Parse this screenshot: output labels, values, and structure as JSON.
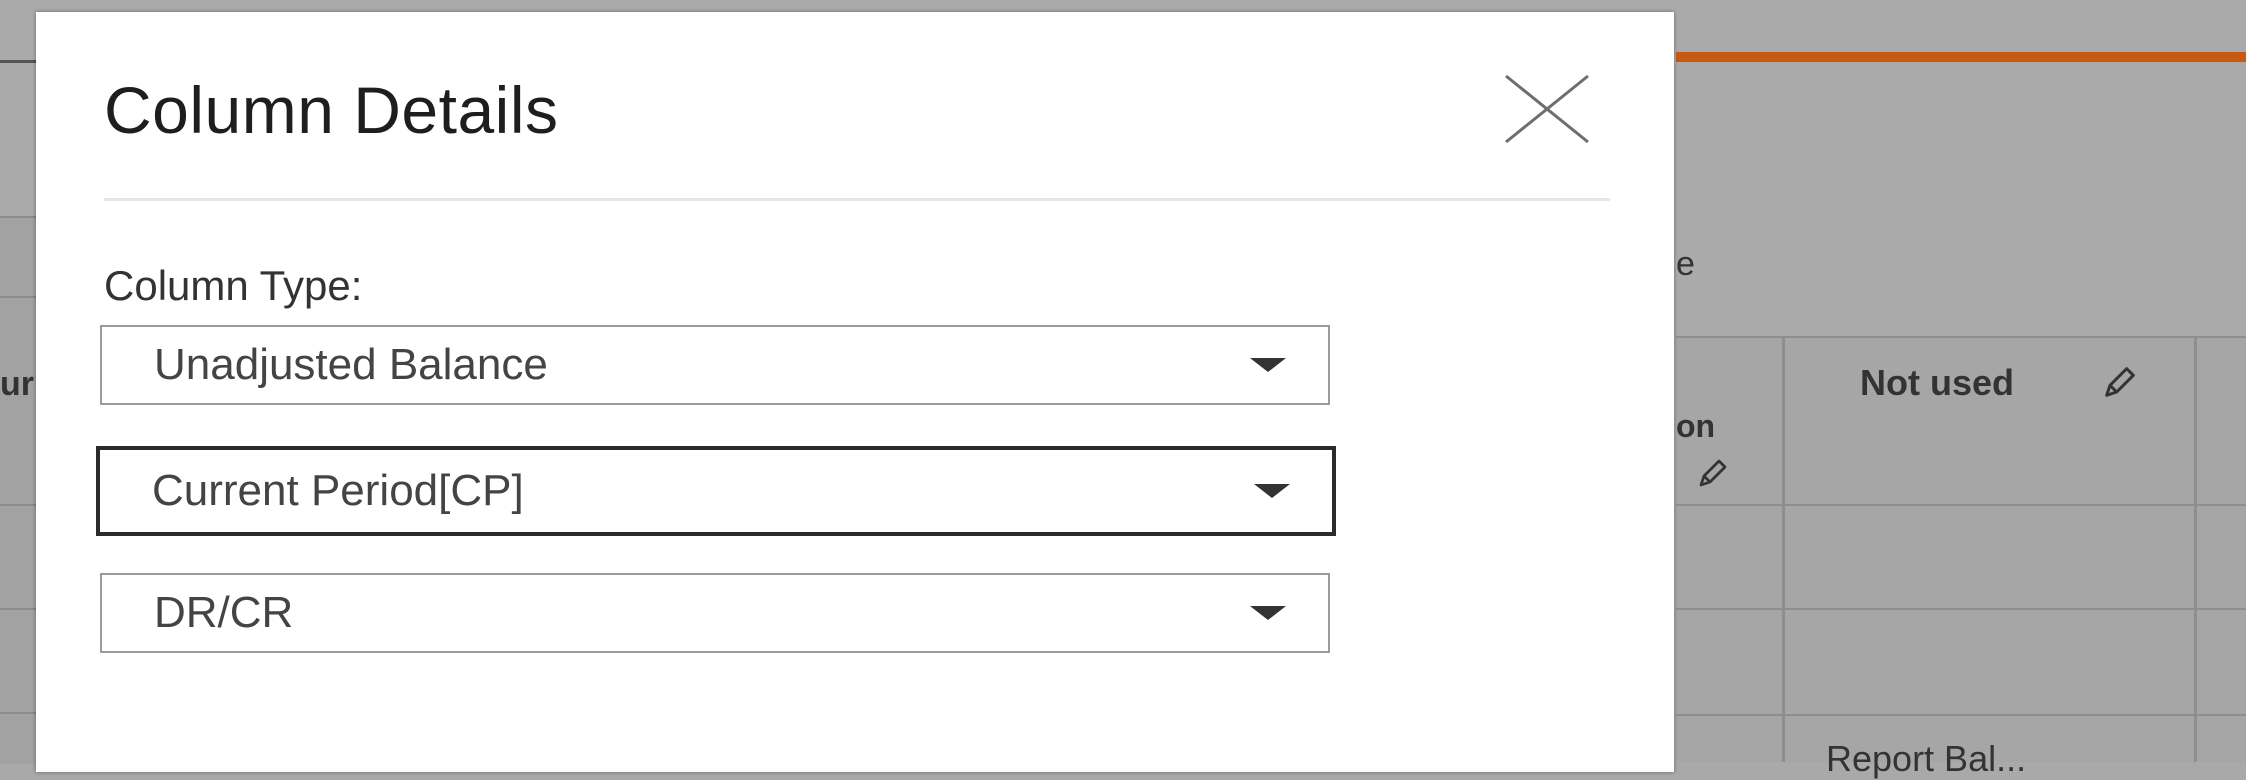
{
  "background": {
    "left_partial_text": "ur",
    "partial_e": "e",
    "table": {
      "header_partial": "on",
      "header_not_used": "Not used",
      "cell_partial": "Report Bal..."
    },
    "colors": {
      "accent_bar": "#c55a11"
    }
  },
  "modal": {
    "title": "Column Details",
    "close_icon": "close-icon",
    "column_type_label": "Column Type:",
    "selects": [
      {
        "value": "Unadjusted Balance",
        "focused": false
      },
      {
        "value": "Current Period[CP]",
        "focused": true
      },
      {
        "value": "DR/CR",
        "focused": false
      }
    ]
  }
}
